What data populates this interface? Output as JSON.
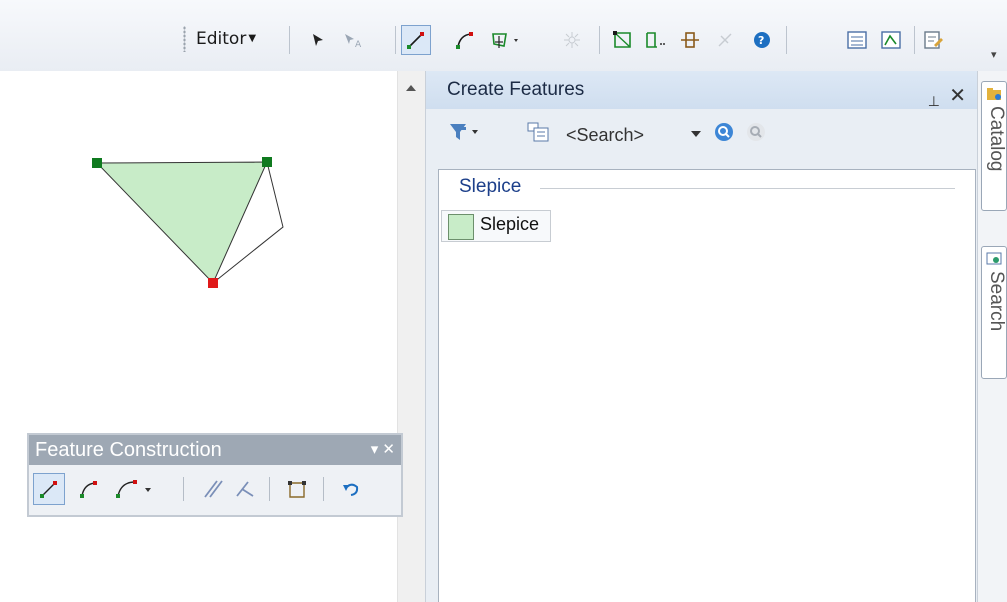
{
  "toolbar": {
    "editor_label": "Editor",
    "tools": [
      "edit-tool-icon",
      "edit-annotation-icon",
      "straight-segment-icon",
      "end-point-arc-icon",
      "cut-polygons-icon",
      "split-tool-icon",
      "reshape-feature-icon",
      "topology-edit-icon",
      "rotate-icon",
      "explode-icon",
      "sketch-properties-icon",
      "attributes-icon",
      "edit-vertices-icon",
      "create-features-icon",
      "overflow-chevron-icon"
    ]
  },
  "feature_construction": {
    "title": "Feature Construction",
    "controls": "▾ ✕"
  },
  "create_features": {
    "title": "Create Features",
    "pin": "⊥",
    "close": "✕",
    "search_placeholder": "<Search>",
    "group_label": "Slepice",
    "template_label": "Slepice"
  },
  "dock": {
    "tabs": [
      {
        "label": "Catalog"
      },
      {
        "label": "Search"
      }
    ]
  },
  "colors": {
    "polygon_fill": "#c8ecc8",
    "vertex_green": "#0f7a1f",
    "vertex_selected": "#e01919",
    "panel_title": "#9ea8b4",
    "group_header": "#1c3f8a"
  }
}
